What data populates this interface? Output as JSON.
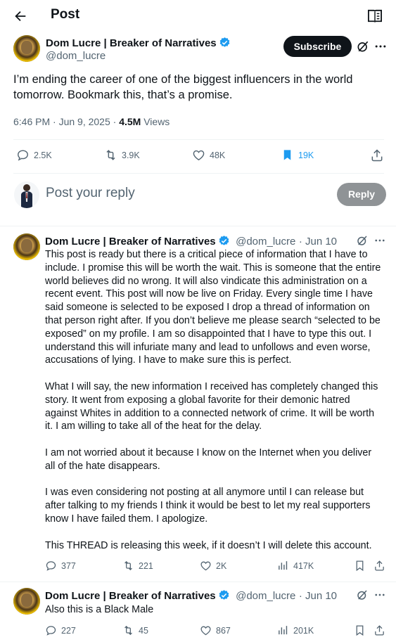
{
  "header": {
    "title": "Post"
  },
  "main_post": {
    "author_name": "Dom Lucre | Breaker of Narratives",
    "handle": "@dom_lucre",
    "subscribe_label": "Subscribe",
    "text": "I’m ending the career of one of the biggest influencers in the world tomorrow. Bookmark this, that’s a promise.",
    "time": "6:46 PM · Jun 9, 2025 · ",
    "views_count": "4.5M",
    "views_label": "Views",
    "stats": {
      "replies": "2.5K",
      "reposts": "3.9K",
      "likes": "48K",
      "bookmarks": "19K"
    }
  },
  "reply_box": {
    "placeholder": "Post your reply",
    "button_label": "Reply"
  },
  "replies": [
    {
      "author_name": "Dom Lucre | Breaker of Narratives",
      "handle": "@dom_lucre",
      "date": "· Jun 10",
      "paragraphs": [
        "This post is ready but there is a critical piece of information that I have to include. I promise this will be worth the wait. This is someone that the entire world believes did no wrong. It will also vindicate this administration on a recent event. This post will now be live on Friday. Every single time I have said someone is selected to be exposed I drop a thread of information on that person right after. If you don’t believe me please search “selected to be exposed” on my profile. I am so disappointed that I have to type this out. I understand this will infuriate many and lead to unfollows and even worse, accusations of lying. I have to make sure this is perfect.",
        "What I will say, the new information I received has completely changed this story. It went from exposing a global favorite for their demonic hatred against Whites in addition to a connected network of crime. It will be worth it. I am willing to take all of the heat for the delay.",
        "I am not worried about it because I know on the Internet when you deliver all of the hate disappears.",
        "I was even considering not posting at all anymore until I can release but after talking to my friends I think it would be best to let my real supporters know I have failed them. I apologize.",
        "This THREAD is releasing this week, if it doesn’t I will delete this account."
      ],
      "stats": {
        "replies": "377",
        "reposts": "221",
        "likes": "2K",
        "views": "417K"
      }
    },
    {
      "author_name": "Dom Lucre | Breaker of Narratives",
      "handle": "@dom_lucre",
      "date": "· Jun 10",
      "paragraphs": [
        "Also this is a Black Male"
      ],
      "stats": {
        "replies": "227",
        "reposts": "45",
        "likes": "867",
        "views": "201K"
      }
    }
  ],
  "colors": {
    "accent": "#1d9bf0",
    "text": "#0f1419",
    "muted": "#536471",
    "divider": "#eff3f4",
    "reply_button": "#8f9396"
  },
  "icons": [
    "back-arrow-icon",
    "reader-mode-icon",
    "verified-badge-icon",
    "grok-icon",
    "more-icon",
    "reply-icon",
    "repost-icon",
    "like-icon",
    "bookmark-icon",
    "share-icon",
    "views-icon"
  ]
}
